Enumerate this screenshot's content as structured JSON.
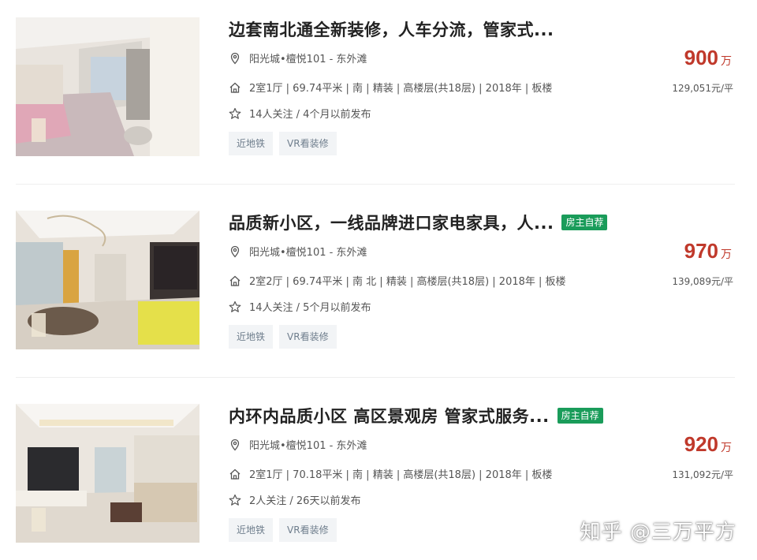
{
  "listings": [
    {
      "title": "边套南北通全新装修，人车分流，管家式...",
      "badge": "",
      "location": "阳光城•檀悦101 - 东外滩",
      "house_info": "2室1厅 | 69.74平米 | 南 | 精装 | 高楼层(共18层) | 2018年 | 板楼",
      "follow_info": "14人关注 / 4个月以前发布",
      "tags": [
        "近地铁",
        "VR看装修"
      ],
      "price": "900",
      "price_unit": "万",
      "unit_price": "129,051元/平"
    },
    {
      "title": "品质新小区，一线品牌进口家电家具，人...",
      "badge": "房主自荐",
      "location": "阳光城•檀悦101 - 东外滩",
      "house_info": "2室2厅 | 69.74平米 | 南 北 | 精装 | 高楼层(共18层) | 2018年 | 板楼",
      "follow_info": "14人关注 / 5个月以前发布",
      "tags": [
        "近地铁",
        "VR看装修"
      ],
      "price": "970",
      "price_unit": "万",
      "unit_price": "139,089元/平"
    },
    {
      "title": "内环内品质小区 高区景观房 管家式服务...",
      "badge": "房主自荐",
      "location": "阳光城•檀悦101 - 东外滩",
      "house_info": "2室1厅 | 70.18平米 | 南 | 精装 | 高楼层(共18层) | 2018年 | 板楼",
      "follow_info": "2人关注 / 26天以前发布",
      "tags": [
        "近地铁",
        "VR看装修"
      ],
      "price": "920",
      "price_unit": "万",
      "unit_price": "131,092元/平"
    }
  ],
  "watermark": "知乎 @三万平方",
  "colors": {
    "price": "#c0392b",
    "badge": "#1a9c5a",
    "tag_bg": "#f2f4f6",
    "tag_text": "#6e7d8c"
  },
  "icons": {
    "location": "location-pin-icon",
    "house": "house-icon",
    "follow": "star-icon"
  }
}
